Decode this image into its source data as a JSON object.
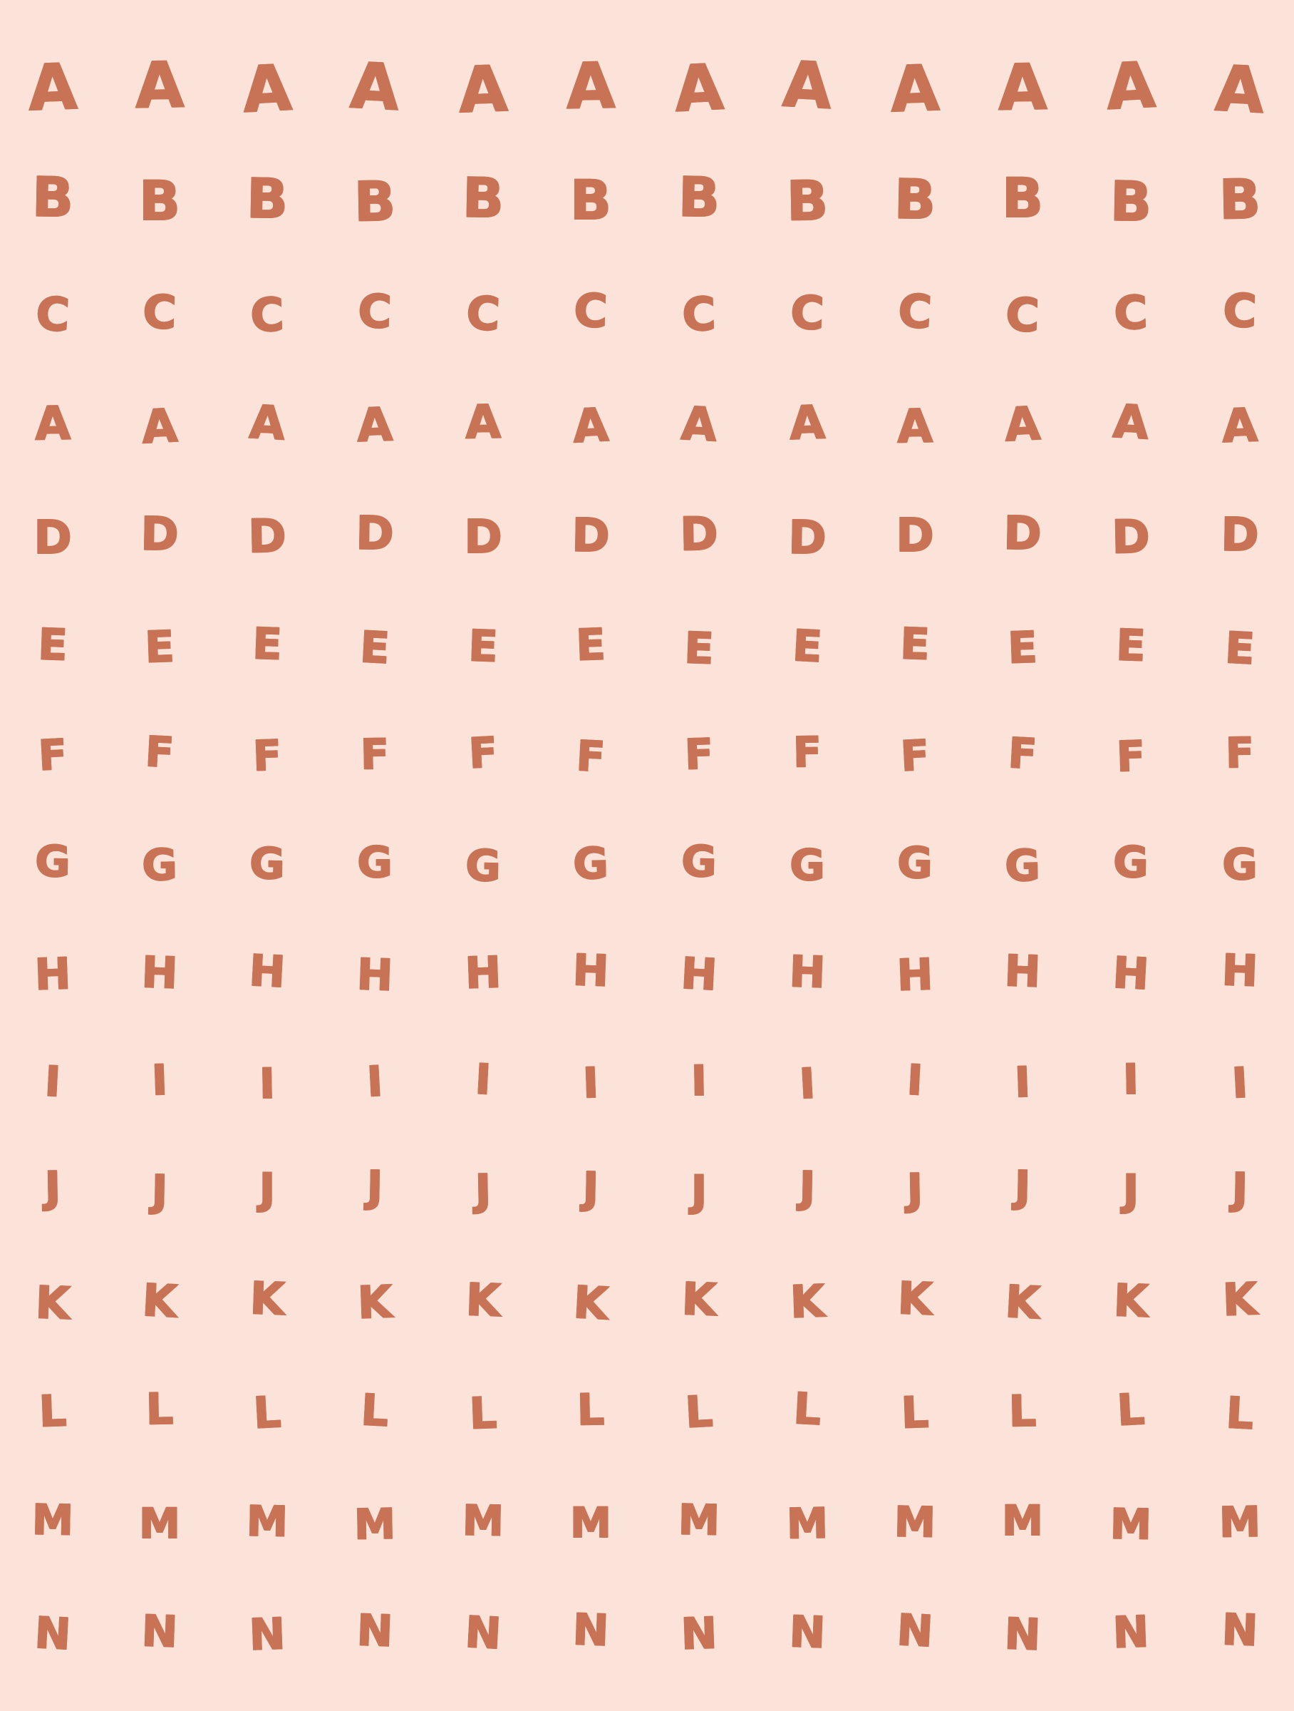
{
  "colors": {
    "background": "#fce3d9",
    "letter": "#c97356"
  },
  "grid": {
    "rows": [
      {
        "letter": "A",
        "count": 12
      },
      {
        "letter": "B",
        "count": 12
      },
      {
        "letter": "C",
        "count": 12
      },
      {
        "letter": "A",
        "count": 12
      },
      {
        "letter": "D",
        "count": 12
      },
      {
        "letter": "E",
        "count": 12
      },
      {
        "letter": "F",
        "count": 12
      },
      {
        "letter": "G",
        "count": 12
      },
      {
        "letter": "H",
        "count": 12
      },
      {
        "letter": "I",
        "count": 12
      },
      {
        "letter": "J",
        "count": 12
      },
      {
        "letter": "K",
        "count": 12
      },
      {
        "letter": "L",
        "count": 12
      },
      {
        "letter": "M",
        "count": 12
      },
      {
        "letter": "N",
        "count": 12
      }
    ]
  }
}
